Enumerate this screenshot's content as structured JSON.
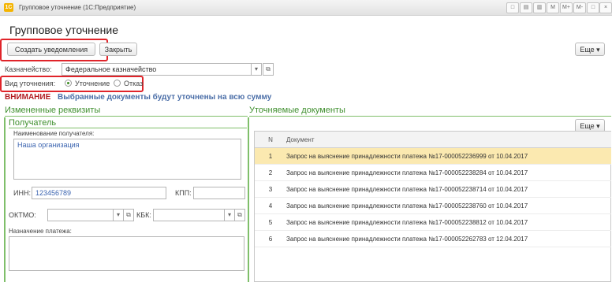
{
  "window": {
    "title": "Групповое уточнение  (1С:Предприятие)",
    "app_icon_text": "1С",
    "controls": [
      "□",
      "▤",
      "▥",
      "M",
      "M+",
      "M-",
      "□",
      "×"
    ]
  },
  "page": {
    "title": "Групповое уточнение"
  },
  "toolbar": {
    "create_label": "Создать уведомления",
    "close_label": "Закрыть",
    "more_label": "Еще ▾"
  },
  "treasury": {
    "label": "Казначейство:",
    "value": "Федеральное казначейство",
    "dropdown_icon": "▾",
    "open_icon": "⧉"
  },
  "clarification_type": {
    "label": "Вид уточнения:",
    "option_1": "Уточнение",
    "option_2": "Отказ",
    "selected": "Уточнение"
  },
  "warning": {
    "label": "ВНИМАНИЕ",
    "text": "Выбранные документы будут уточнены на всю сумму"
  },
  "left_panel": {
    "title": "Измененные реквизиты",
    "recipient_title": "Получатель",
    "recipient_name_label": "Наименование получателя:",
    "recipient_name_value": "Наша организация",
    "inn_label": "ИНН:",
    "inn_value": "123456789",
    "kpp_label": "КПП:",
    "kpp_value": "",
    "oktmo_label": "ОКТМО:",
    "kbk_label": "КБК:",
    "purpose_label": "Назначение платежа:"
  },
  "right_panel": {
    "title": "Уточняемые документы",
    "more_label": "Еще ▾",
    "col_n": "N",
    "col_doc": "Документ",
    "rows": [
      {
        "n": "1",
        "doc": "Запрос на выяснение принадлежности платежа №17-000052236999 от 10.04.2017"
      },
      {
        "n": "2",
        "doc": "Запрос на выяснение принадлежности платежа №17-000052238284 от 10.04.2017"
      },
      {
        "n": "3",
        "doc": "Запрос на выяснение принадлежности платежа №17-000052238714 от 10.04.2017"
      },
      {
        "n": "4",
        "doc": "Запрос на выяснение принадлежности платежа №17-000052238760 от 10.04.2017"
      },
      {
        "n": "5",
        "doc": "Запрос на выяснение принадлежности платежа №17-000052238812 от 10.04.2017"
      },
      {
        "n": "6",
        "doc": "Запрос на выяснение принадлежности платежа №17-000052262783 от 12.04.2017"
      }
    ]
  },
  "colors": {
    "accent_green": "#3f8f2e",
    "highlight_red": "#e0242a",
    "selected_row": "#fbe9b0"
  }
}
